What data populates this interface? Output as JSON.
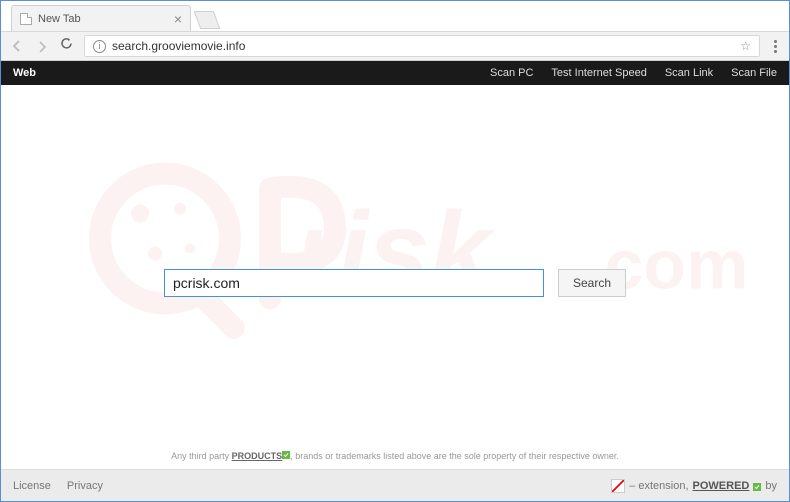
{
  "window": {
    "tab_title": "New Tab"
  },
  "addressbar": {
    "url": "search.grooviemovie.info"
  },
  "blackbar": {
    "web": "Web",
    "links": [
      "Scan PC",
      "Test Internet Speed",
      "Scan Link",
      "Scan File"
    ]
  },
  "search": {
    "value": "pcrisk.com",
    "button": "Search"
  },
  "disclaimer": {
    "prefix": "Any third party ",
    "products": "PRODUCTS",
    "suffix": ", brands or trademarks listed above are the sole property of their respective owner."
  },
  "footer": {
    "license": "License",
    "privacy": "Privacy",
    "ext_text": " – extension, ",
    "powered": "POWERED",
    "by": " by"
  },
  "watermark": {
    "text": "pcrisk.com"
  }
}
